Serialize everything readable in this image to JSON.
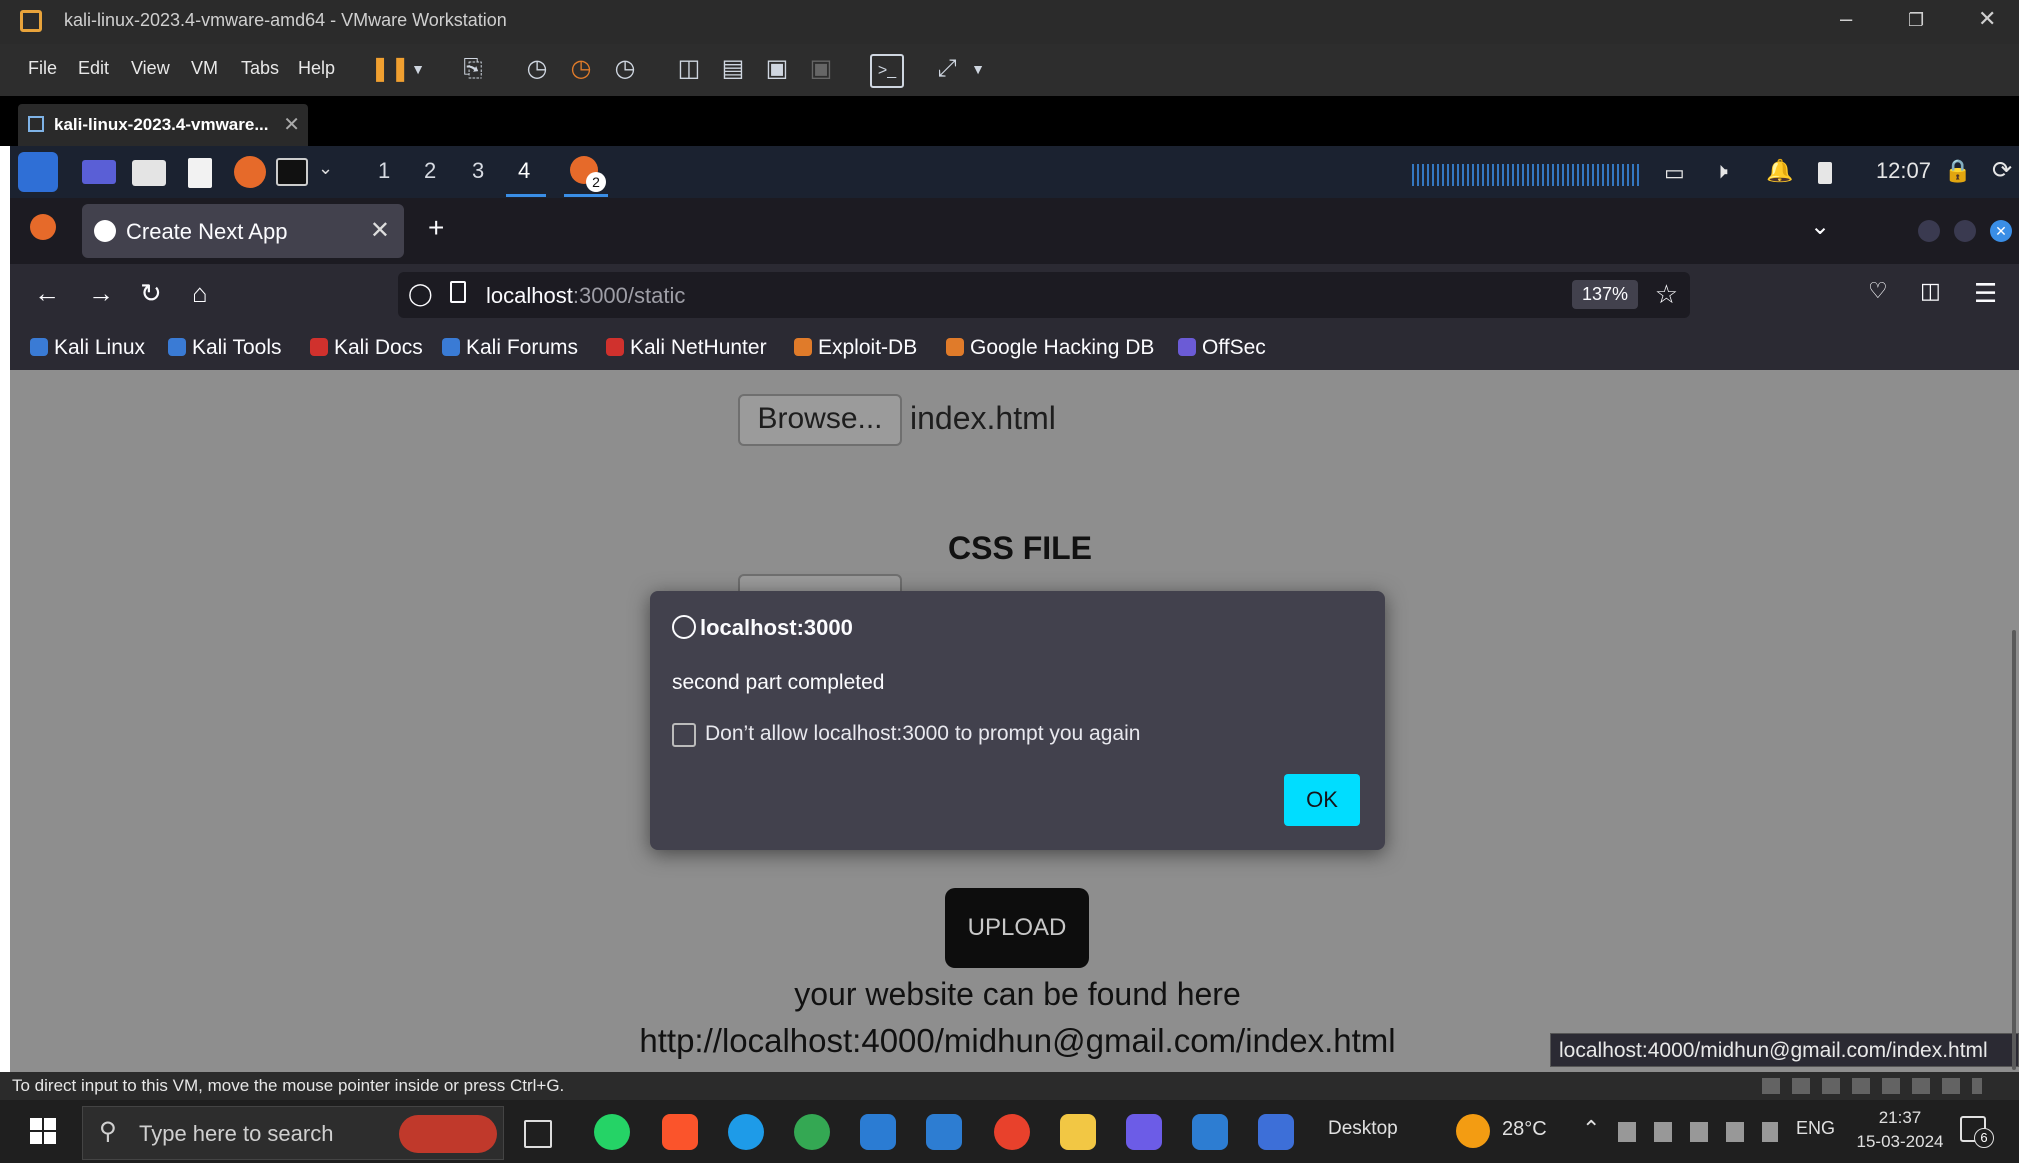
{
  "vmware": {
    "window_title": "kali-linux-2023.4-vmware-amd64 - VMware Workstation",
    "menu": [
      "File",
      "Edit",
      "View",
      "VM",
      "Tabs",
      "Help"
    ],
    "tab_label": "kali-linux-2023.4-vmware...",
    "status_text": "To direct input to this VM, move the mouse pointer inside or press Ctrl+G."
  },
  "kali_panel": {
    "workspaces": [
      "1",
      "2",
      "3",
      "4"
    ],
    "active_workspace": "4",
    "firefox_badge": "2",
    "clock": "12:07"
  },
  "firefox": {
    "tab_title": "Create Next App",
    "url_host": "localhost",
    "url_path": ":3000/static",
    "zoom": "137%",
    "bookmarks": [
      {
        "label": "Kali Linux",
        "color": "#3a7bd5"
      },
      {
        "label": "Kali Tools",
        "color": "#3a7bd5"
      },
      {
        "label": "Kali Docs",
        "color": "#d0312d"
      },
      {
        "label": "Kali Forums",
        "color": "#3a7bd5"
      },
      {
        "label": "Kali NetHunter",
        "color": "#d0312d"
      },
      {
        "label": "Exploit-DB",
        "color": "#e07b2a"
      },
      {
        "label": "Google Hacking DB",
        "color": "#e07b2a"
      },
      {
        "label": "OffSec",
        "color": "#6b5bd6"
      }
    ]
  },
  "page": {
    "browse_label": "Browse...",
    "html_file_name": "index.html",
    "css_heading": "CSS FILE",
    "upload_label": "UPLOAD",
    "found_text": "your website can be found here",
    "found_url": "http://localhost:4000/midhun@gmail.com/index.html",
    "status_tooltip": "localhost:4000/midhun@gmail.com/index.html"
  },
  "dialog": {
    "origin": "localhost:3000",
    "message": "second part completed",
    "checkbox_label": "Don’t allow localhost:3000 to prompt you again",
    "checkbox_checked": false,
    "ok_label": "OK",
    "accent_color": "#00ddff"
  },
  "taskbar": {
    "search_placeholder": "Type here to search",
    "desktop_label": "Desktop",
    "temperature": "28°C",
    "language": "ENG",
    "time": "21:37",
    "date": "15-03-2024",
    "notification_count": "6"
  }
}
